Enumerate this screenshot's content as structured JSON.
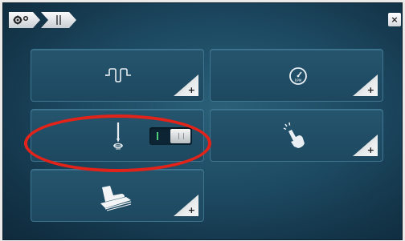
{
  "header": {
    "close_label": "×"
  },
  "tiles": [
    {
      "id": "thread-tension",
      "icon": "thread-tension-icon",
      "plus_label": "+"
    },
    {
      "id": "speed",
      "icon": "speedometer-rpm-icon",
      "icon_text": "RPM",
      "plus_label": "+"
    },
    {
      "id": "needle-stop",
      "icon": "needle-stop-icon",
      "plus_label": null,
      "toggle_state": "on"
    },
    {
      "id": "touch-gesture",
      "icon": "hand-tap-icon",
      "plus_label": "+"
    },
    {
      "id": "foot-control",
      "icon": "foot-control-icon",
      "plus_label": "+"
    }
  ],
  "colors": {
    "background": "#1d4a63",
    "tile": "#25556d",
    "toggle_on": "#4bd07a",
    "annotation": "#e2231a"
  }
}
